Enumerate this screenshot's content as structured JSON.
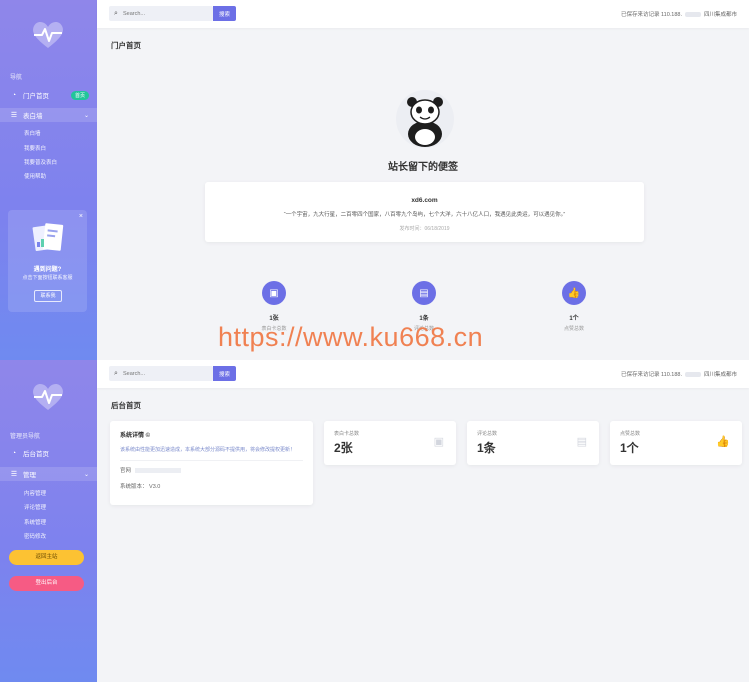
{
  "colors": {
    "sidebar_gradient_top": "#8f86ea",
    "sidebar_gradient_bottom": "#6f8af0",
    "accent": "#6c6fe6",
    "badge_green": "#22c59a",
    "button_yellow": "#fcc233",
    "button_pink": "#f65b84",
    "watermark": "#f07845"
  },
  "top": {
    "sidebar": {
      "logo_icon": "heartbeat-icon",
      "section_label": "导航",
      "items": [
        {
          "label": "门户首页",
          "icon": "dashboard-icon",
          "badge": "首页"
        },
        {
          "label": "表白墙",
          "icon": "list-icon"
        }
      ],
      "sub_items": [
        "表白墙",
        "我要表白",
        "我要普及表白",
        "使用帮助"
      ],
      "promo": {
        "title": "遇到问题?",
        "subtitle": "点击下面按钮联系客服",
        "button": "联系我"
      }
    },
    "header": {
      "search_placeholder": "Search...",
      "search_button": "搜索",
      "status_prefix": "已保存来访记录 110.188.",
      "status_suffix": "四川集成都市"
    },
    "page_title": "门户首页",
    "note_title": "站长留下的便签",
    "note": {
      "site": "xd6.com",
      "text": "“一个宇宙，九大行星，二百零四个国家，八百零九个岛屿，七个大洋，六十八亿人口，我遇见此类运，可以遇见你。”",
      "time": "发布时间：06/18/2019"
    },
    "stats": [
      {
        "value": "1张",
        "label": "表白卡总数",
        "icon": "card-icon"
      },
      {
        "value": "1条",
        "label": "评论总数",
        "icon": "comment-icon"
      },
      {
        "value": "1个",
        "label": "点赞总数",
        "icon": "thumbs-up-icon"
      }
    ]
  },
  "watermark": "https://www.ku668.cn",
  "bottom": {
    "sidebar": {
      "logo_icon": "heartbeat-icon",
      "section_label": "管理员导航",
      "items": [
        {
          "label": "后台首页",
          "icon": "dashboard-icon"
        },
        {
          "label": "管理",
          "icon": "list-icon"
        }
      ],
      "sub_items": [
        "内容管理",
        "评论管理",
        "系统管理",
        "密码修改"
      ],
      "buttons": [
        "返回主站",
        "登出后台"
      ]
    },
    "header": {
      "search_placeholder": "Search...",
      "search_button": "搜索",
      "status_prefix": "已保存来访记录 110.188.",
      "status_suffix": "四川集成都市"
    },
    "page_title": "后台首页",
    "info_card": {
      "title": "系统详情 ©",
      "description": "该系统由性能更加迅速造成，本系统大部分源码不提供用，将会修改提权更新！",
      "row1_label": "官网",
      "row2_label": "系统版本：",
      "row2_value": "V3.0"
    },
    "stat_cards": [
      {
        "label": "表白卡总数",
        "value": "2张",
        "icon": "card-icon"
      },
      {
        "label": "评论总数",
        "value": "1条",
        "icon": "comment-icon"
      },
      {
        "label": "点赞总数",
        "value": "1个",
        "icon": "thumbs-up-icon"
      }
    ]
  }
}
